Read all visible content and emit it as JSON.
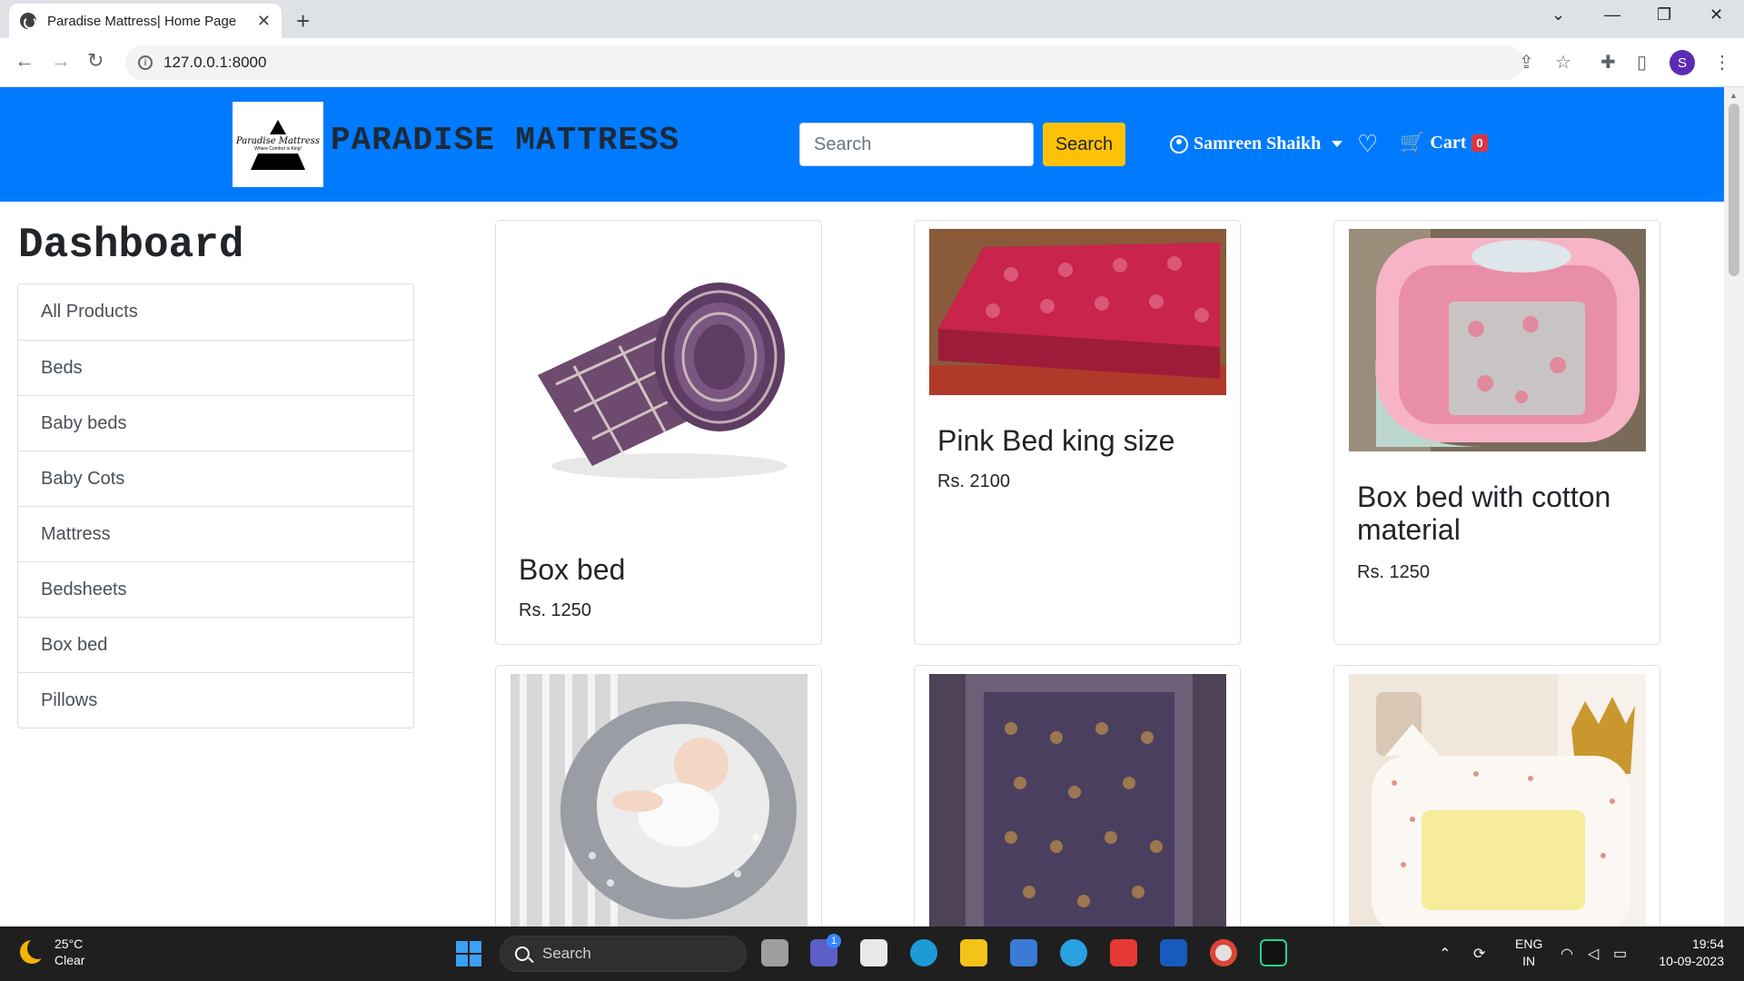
{
  "browser": {
    "tab_title": "Paradise Mattress| Home Page",
    "url": "127.0.0.1:8000",
    "profile_initial": "S"
  },
  "site": {
    "logo_name": "Paradise Mattress",
    "logo_tagline": "Where Comfort is King!",
    "brand": "PARADISE MATTRESS",
    "search_placeholder": "Search",
    "search_button": "Search",
    "user_name": "Samreen Shaikh",
    "cart_label": "Cart",
    "cart_count": "0",
    "colors": {
      "navbar": "#007bff",
      "search_button": "#ffc107",
      "badge": "#dc3545"
    }
  },
  "dashboard": {
    "title": "Dashboard",
    "categories": [
      "All Products",
      "Beds",
      "Baby beds",
      "Baby Cots",
      "Mattress",
      "Bedsheets",
      "Box bed",
      "Pillows"
    ]
  },
  "products": [
    {
      "title": "Box bed",
      "price": "Rs. 1250",
      "image": "rolled-checked-mattress"
    },
    {
      "title": "Pink Bed king size",
      "price": "Rs. 2100",
      "image": "pink-floral-mattress"
    },
    {
      "title": "Box bed with cotton material",
      "price": "Rs. 1250",
      "image": "pink-baby-nest"
    },
    {
      "title": "",
      "price": "",
      "image": "grey-baby-nest"
    },
    {
      "title": "",
      "price": "",
      "image": "brown-floral-mattress"
    },
    {
      "title": "",
      "price": "",
      "image": "crown-baby-nest"
    }
  ],
  "taskbar": {
    "temperature": "25°C",
    "condition": "Clear",
    "search_label": "Search",
    "lang1": "ENG",
    "lang2": "IN",
    "time": "19:54",
    "date": "10-09-2023",
    "teams_badge": "1"
  }
}
